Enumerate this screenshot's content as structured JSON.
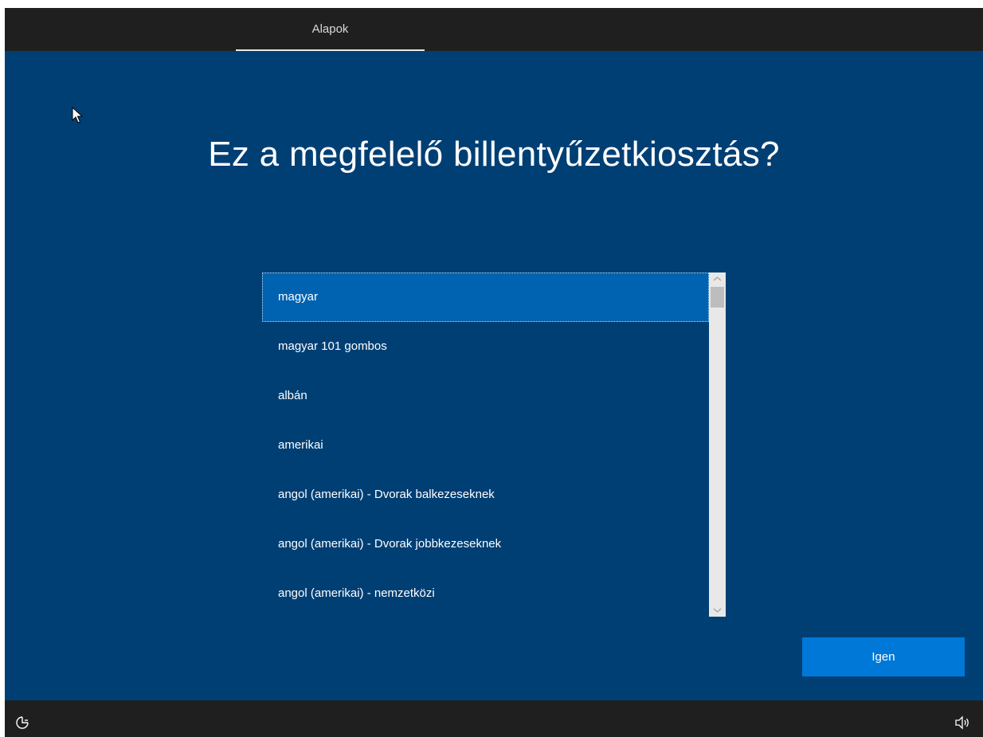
{
  "header": {
    "tab_label": "Alapok"
  },
  "main": {
    "title": "Ez a megfelelő billentyűzetkiosztás?",
    "layouts": [
      {
        "label": "magyar",
        "selected": true
      },
      {
        "label": "magyar 101 gombos",
        "selected": false
      },
      {
        "label": "albán",
        "selected": false
      },
      {
        "label": "amerikai",
        "selected": false
      },
      {
        "label": "angol (amerikai) - Dvorak balkezeseknek",
        "selected": false
      },
      {
        "label": "angol (amerikai) - Dvorak jobbkezeseknek",
        "selected": false
      },
      {
        "label": "angol (amerikai) - nemzetközi",
        "selected": false
      }
    ],
    "confirm_label": "Igen"
  },
  "footer": {
    "left_icon": "accessibility-icon",
    "right_icon": "volume-icon"
  },
  "colors": {
    "background": "#003f74",
    "selected_item": "#0063b1",
    "button": "#0078d7",
    "bars": "#1f1f1f"
  }
}
